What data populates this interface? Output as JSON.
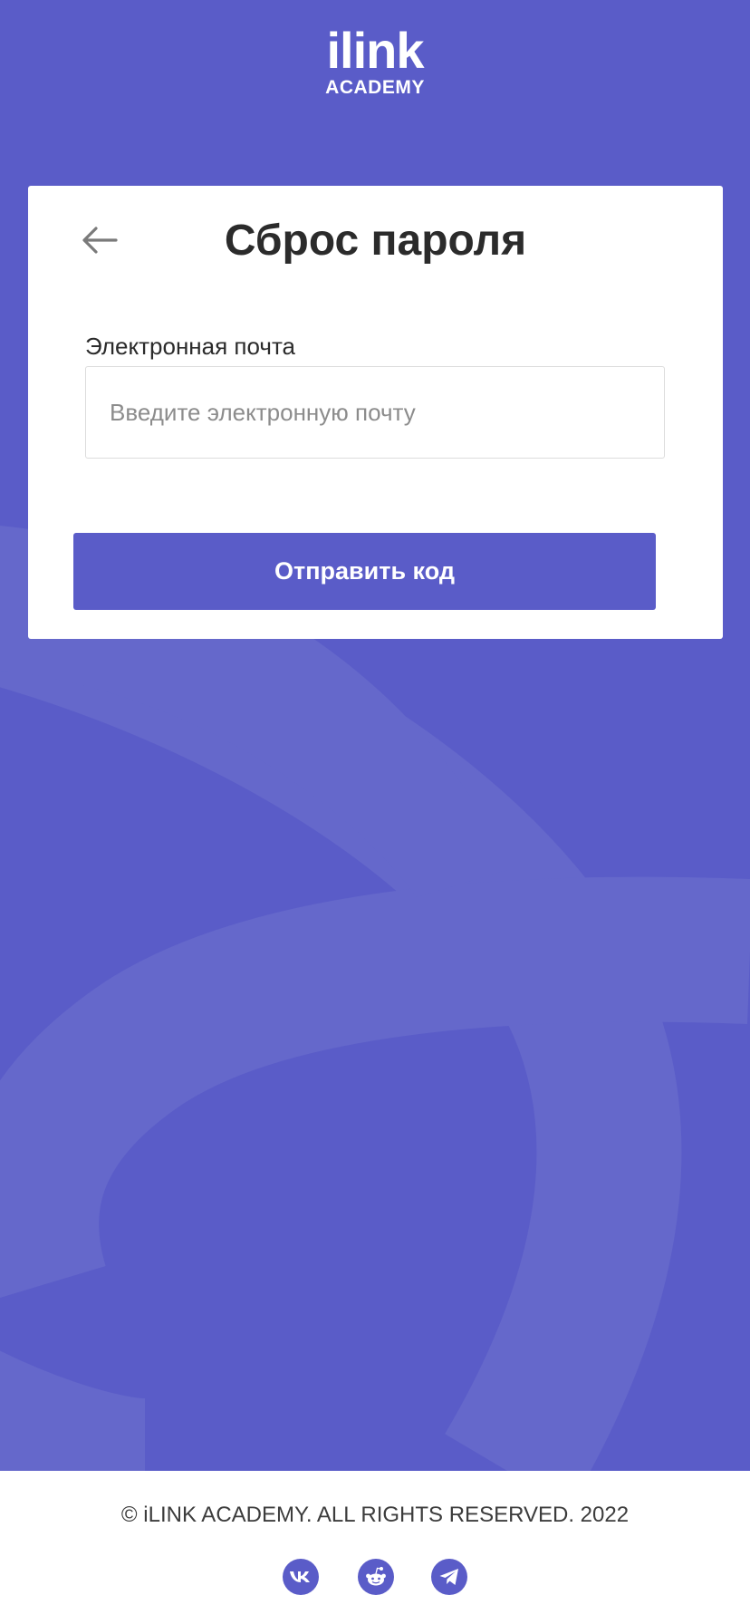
{
  "logo": {
    "main": "ilink",
    "sub": "ACADEMY"
  },
  "reset": {
    "title": "Сброс пароля",
    "back_icon": "arrow-left-icon",
    "email_label": "Электронная почта",
    "email_value": "",
    "email_placeholder": "Введите электронную почту",
    "submit_label": "Отправить код"
  },
  "footer": {
    "copyright": "© iLINK ACADEMY. ALL RIGHTS RESERVED. 2022",
    "social": [
      {
        "name": "vk-icon"
      },
      {
        "name": "reddit-icon"
      },
      {
        "name": "telegram-icon"
      }
    ]
  },
  "colors": {
    "brand": "#5a5cc8",
    "brand_light": "#6568cb",
    "card": "#ffffff",
    "text": "#2b2b2b"
  }
}
